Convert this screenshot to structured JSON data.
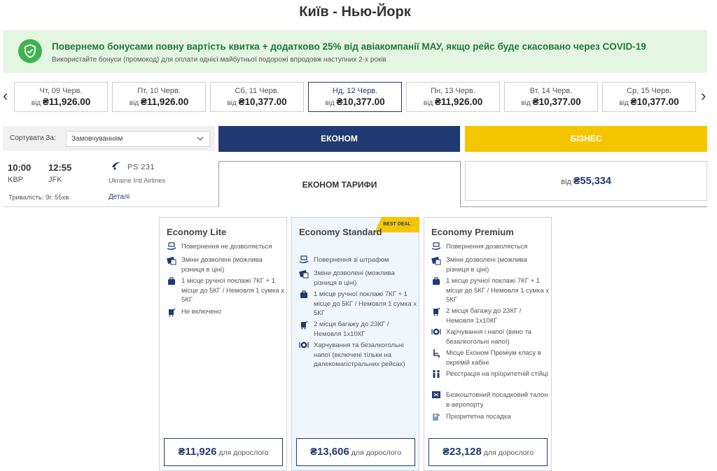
{
  "title": "Київ - Нью-Йорк",
  "banner": {
    "main": "Повернемо бонусами повну вартість квитка + додатково 25% від авіакомпанії МАУ, якщо рейс буде скасовано через COVID-19",
    "sub": "Використайте бонуси (промокод) для оплати однієї майбутньої подорожі впродовж наступних 2-х років",
    "accent": "#3fb34f"
  },
  "date_bar": {
    "prev": "‹",
    "next": "›",
    "dates": [
      {
        "day": "Чт, 09 Черв.",
        "from": "від",
        "price": "₴11,926.00"
      },
      {
        "day": "Пт, 10 Черв.",
        "from": "від",
        "price": "₴11,926.00"
      },
      {
        "day": "Сб, 11 Черв.",
        "from": "від",
        "price": "₴10,377.00"
      },
      {
        "day": "Нд, 12 Черв.",
        "from": "від",
        "price": "₴10,377.00"
      },
      {
        "day": "Пн, 13 Черв.",
        "from": "від",
        "price": "₴11,926.00"
      },
      {
        "day": "Вт, 14 Черв.",
        "from": "від",
        "price": "₴10,377.00"
      },
      {
        "day": "Ср, 15 Черв.",
        "from": "від",
        "price": "₴10,377.00"
      }
    ],
    "selected_index": 3
  },
  "sort": {
    "label": "Сортувати За:",
    "value": "Замовчуванням"
  },
  "tabs": {
    "economy": "ЕКОНОМ",
    "business": "БІЗНЕС",
    "economy_color": "#223a73",
    "business_color": "#f5c500"
  },
  "flight": {
    "dep_time": "10:00",
    "arr_time": "12:55",
    "dep_airport": "KBP",
    "arr_airport": "JFK",
    "flight_no": "PS  231",
    "airline": "Ukraine Intl Airlines",
    "duration": "Тривалість: 9г. 55хв",
    "details": "Деталі"
  },
  "fares_tab": "ЕКОНОМ ТАРИФИ",
  "business_price": {
    "from": "від",
    "price": "₴55,334"
  },
  "cards": [
    {
      "name": "Economy Lite",
      "features": [
        {
          "icon": "refund-icon",
          "text": "Повернення не дозволяється"
        },
        {
          "icon": "ticket-change-icon",
          "text": "Зміни дозволені (можлива різниця в ціні)"
        },
        {
          "icon": "cabin-bag-icon",
          "text": "1 місце ручної поклажі 7КГ + 1 місце до 5КГ / Немовля 1 сумка х 5КГ"
        },
        {
          "icon": "checked-bag-icon",
          "text": "Не включено"
        }
      ],
      "price": "₴11,926",
      "per": "для дорослого"
    },
    {
      "name": "Economy Standard",
      "badge": "BEST DEAL",
      "features": [
        {
          "icon": "refund-icon",
          "text": "Повернення зі штрафом"
        },
        {
          "icon": "ticket-change-icon",
          "text": "Зміни дозволені (можлива різниця в ціні)"
        },
        {
          "icon": "cabin-bag-icon",
          "text": "1 місце ручної поклажі 7КГ + 1 місце до 5КГ / Немовля 1 сумка х 5КГ"
        },
        {
          "icon": "checked-bag-icon",
          "text": "2 місця багажу до 23КГ / Немовля 1х10КГ"
        },
        {
          "icon": "meal-icon",
          "text": "Харчування та безалкогольні напої (включені тільки на далекомагістральних рейсах)"
        }
      ],
      "price": "₴13,606",
      "per": "для дорослого"
    },
    {
      "name": "Economy Premium",
      "features": [
        {
          "icon": "refund-icon",
          "text": "Повернення дозволяється"
        },
        {
          "icon": "ticket-change-icon",
          "text": "Зміни дозволені (можлива різниця в ціні)"
        },
        {
          "icon": "cabin-bag-icon",
          "text": "1 місце ручної поклажі 7КГ + 1 місце до 5КГ / Немовля 1 сумка х 5КГ"
        },
        {
          "icon": "checked-bag-icon",
          "text": "2 місця багажу до 23КГ / Немовля 1х10КГ"
        },
        {
          "icon": "meal-icon",
          "text": "Харчування і напої (вино та безалкогольні напої)"
        },
        {
          "icon": "seat-icon",
          "text": "Місце Економ Преміум класу в окремій кабіні"
        },
        {
          "icon": "priority-checkin-icon",
          "text": "Реєстрація на пріоритетній стійці"
        },
        {
          "icon": "boarding-pass-icon",
          "text": "Безкоштовний посадковий талон в аеропорту"
        },
        {
          "icon": "priority-boarding-icon",
          "text": "Пріоритетна посадка"
        }
      ],
      "price": "₴23,128",
      "per": "для дорослого"
    }
  ]
}
